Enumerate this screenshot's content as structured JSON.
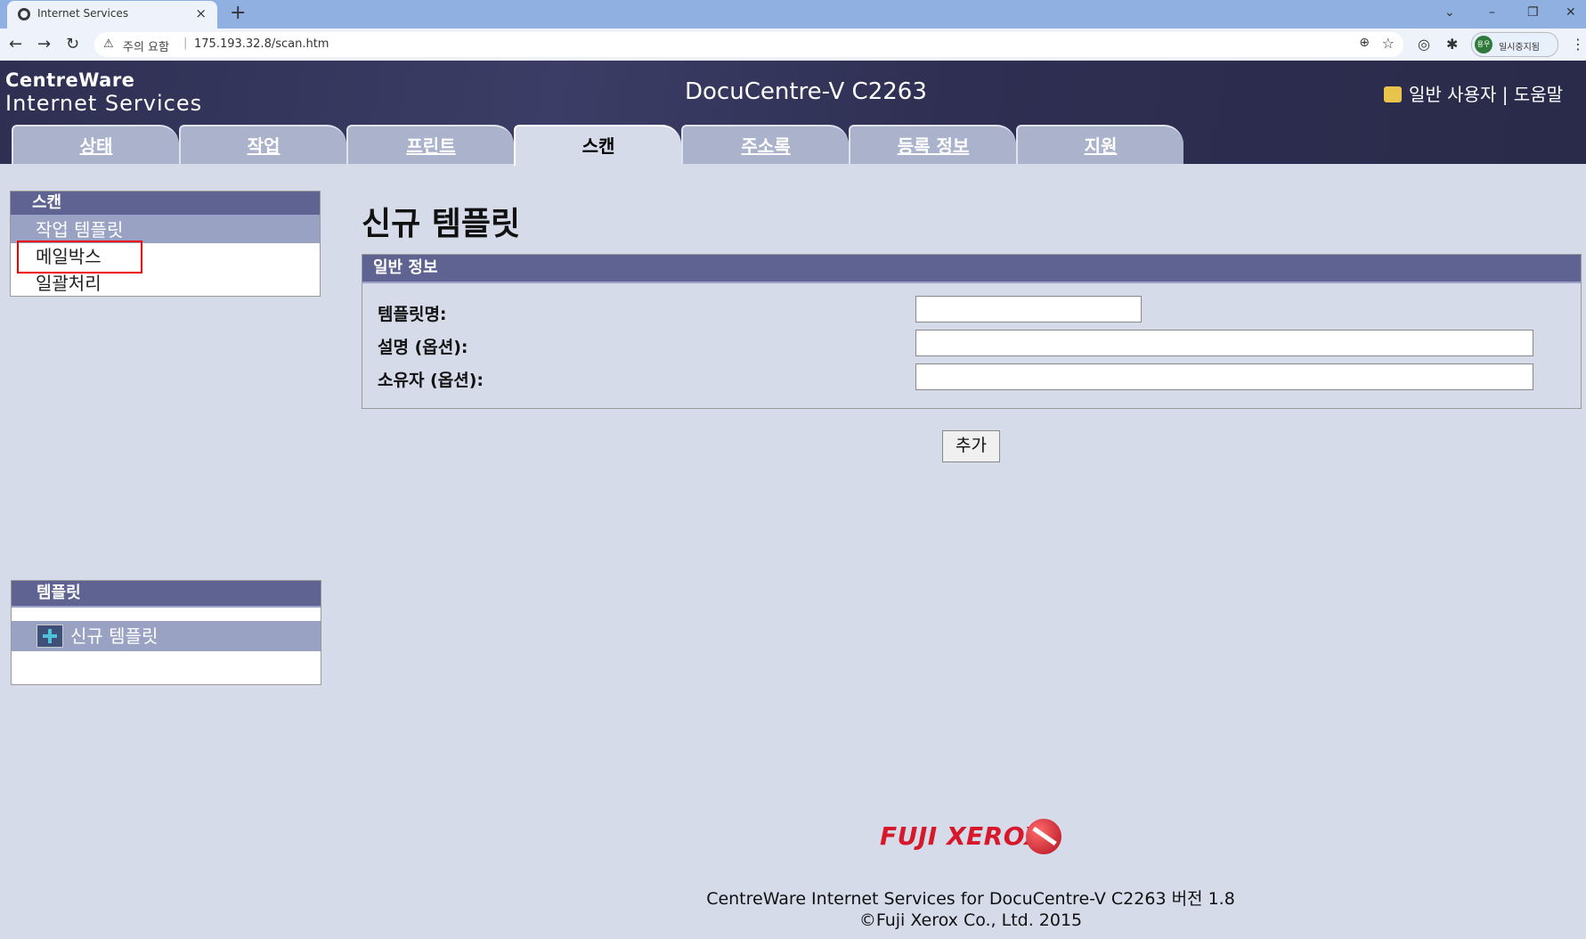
{
  "browser": {
    "tab_title": "Internet Services",
    "close_glyph": "×",
    "new_tab_glyph": "+",
    "security_label": "주의 요함",
    "url": "175.193.32.8/scan.htm",
    "profile_avatar": "용우",
    "profile_label": "일시중지됨"
  },
  "header": {
    "logo_line1": "CentreWare",
    "logo_line2": "Internet Services",
    "device_name": "DocuCentre-V C2263",
    "user_label": "일반 사용자 | 도움말"
  },
  "tabs": [
    {
      "label": "상태"
    },
    {
      "label": "작업"
    },
    {
      "label": "프린트"
    },
    {
      "label": "스캔"
    },
    {
      "label": "주소록"
    },
    {
      "label": "등록 정보"
    },
    {
      "label": "지원"
    }
  ],
  "scan_panel": {
    "title": "스캔",
    "items": [
      {
        "label": "작업 템플릿"
      },
      {
        "label": "메일박스"
      },
      {
        "label": "일괄처리"
      }
    ]
  },
  "template_panel": {
    "title": "템플릿",
    "new_label": "신규 템플릿"
  },
  "main": {
    "title": "신규 템플릿",
    "section_title": "일반 정보",
    "fields": [
      {
        "label": "템플릿명:",
        "value": ""
      },
      {
        "label": "설명 (옵션):",
        "value": ""
      },
      {
        "label": "소유자 (옵션):",
        "value": ""
      }
    ],
    "add_button": "추가"
  },
  "footer": {
    "brand": "FUJI XEROX",
    "line1": "CentreWare Internet Services for DocuCentre-V C2263 버전 1.8",
    "line2": "©Fuji Xerox Co., Ltd. 2015"
  },
  "colors": {
    "header_bg": "#2e2f52",
    "panel_head": "#5f6391",
    "page_bg": "#d5dbe9",
    "brand_red": "#d7182a"
  }
}
